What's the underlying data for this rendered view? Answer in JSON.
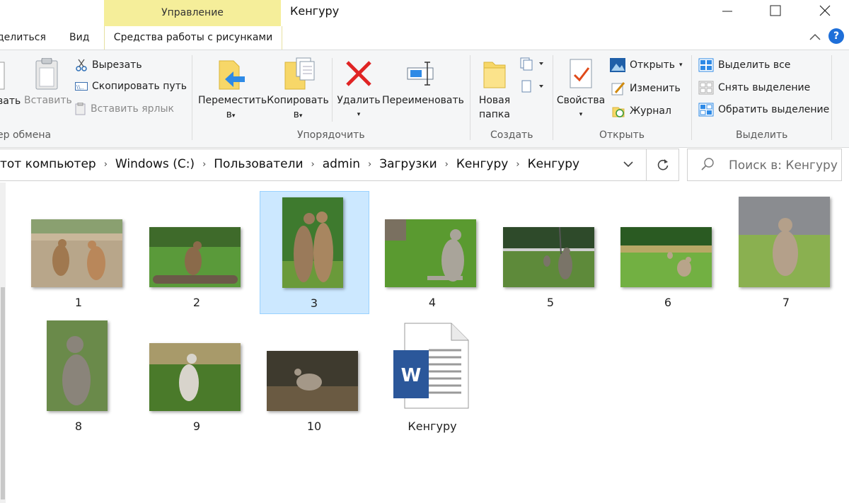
{
  "window": {
    "title": "Кенгуру",
    "contextual_header": "Управление",
    "contextual_tab": "Средства работы с рисунками"
  },
  "tabs": {
    "share": "делиться",
    "view": "Вид"
  },
  "ribbon": {
    "clipboard": {
      "paste_partial": "вать",
      "paste": "Вставить",
      "cut": "Вырезать",
      "copy_path": "Скопировать путь",
      "paste_shortcut": "Вставить ярлык",
      "group": "ер обмена"
    },
    "organize": {
      "move": "Переместить",
      "move_sub": "в",
      "copy": "Копировать",
      "copy_sub": "в",
      "delete": "Удалить",
      "rename": "Переименовать",
      "group": "Упорядочить"
    },
    "new": {
      "new_folder_1": "Новая",
      "new_folder_2": "папка",
      "group": "Создать"
    },
    "open": {
      "properties": "Свойства",
      "open": "Открыть",
      "edit": "Изменить",
      "history": "Журнал",
      "group": "Открыть"
    },
    "select": {
      "select_all": "Выделить все",
      "select_none": "Снять выделение",
      "invert": "Обратить выделение",
      "group": "Выделить"
    }
  },
  "address": {
    "crumbs": [
      "тот компьютер",
      "Windows (C:)",
      "Пользователи",
      "admin",
      "Загрузки",
      "Кенгуру",
      "Кенгуру"
    ]
  },
  "search": {
    "placeholder": "Поиск в: Кенгуру"
  },
  "files": [
    {
      "name": "1",
      "selected": false
    },
    {
      "name": "2",
      "selected": false
    },
    {
      "name": "3",
      "selected": true
    },
    {
      "name": "4",
      "selected": false
    },
    {
      "name": "5",
      "selected": false
    },
    {
      "name": "6",
      "selected": false
    },
    {
      "name": "7",
      "selected": false
    },
    {
      "name": "8",
      "selected": false
    },
    {
      "name": "9",
      "selected": false
    },
    {
      "name": "10",
      "selected": false
    },
    {
      "name": "Кенгуру",
      "selected": false
    }
  ],
  "colors": {
    "accent": "#0078d7",
    "contextual_header": "#f5ee9a",
    "selection": "#cce8ff",
    "word_blue": "#2b579a"
  }
}
